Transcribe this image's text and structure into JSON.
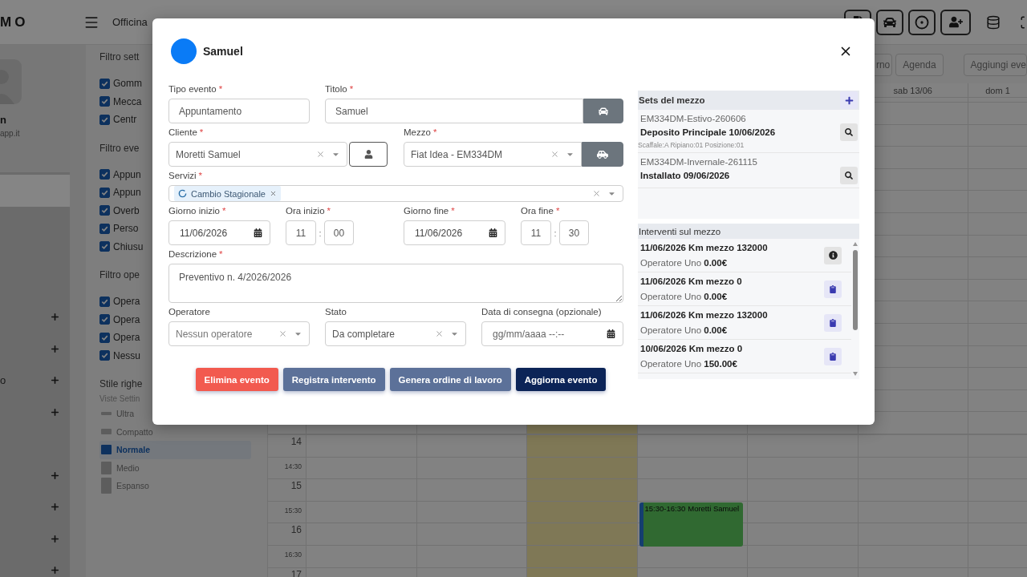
{
  "top_bar": {
    "logo": "MO",
    "title": "Officina",
    "actions": [
      {
        "kind": "document"
      },
      {
        "kind": "car"
      },
      {
        "kind": "target"
      },
      {
        "kind": "add-user"
      },
      {
        "kind": "database"
      },
      {
        "kind": "expand"
      }
    ]
  },
  "sidebar": {
    "user_name": "n",
    "user_email": "app.it",
    "nav_groups": [
      {
        "items": [
          {
            "selected": true,
            "expandable": false
          }
        ]
      },
      {
        "items": [
          {
            "selected": false,
            "expandable": true
          },
          {
            "selected": false,
            "expandable": true
          },
          {
            "selected": false,
            "expandable": true,
            "label": "o"
          },
          {
            "selected": false,
            "expandable": true
          }
        ]
      },
      {
        "items": [
          {
            "selected": false,
            "expandable": true
          },
          {
            "selected": false,
            "expandable": true
          },
          {
            "selected": false,
            "expandable": true
          },
          {
            "selected": false,
            "expandable": true
          }
        ]
      }
    ]
  },
  "filters": [
    {
      "title": "Filtro sett",
      "items": [
        {
          "label": "Gomm",
          "checked": true
        },
        {
          "label": "Mecca",
          "checked": true
        },
        {
          "label": "Centr",
          "checked": true
        }
      ]
    },
    {
      "title": "Filtro eve",
      "items": [
        {
          "label": "Appun",
          "checked": true
        },
        {
          "label": "Appun",
          "checked": true
        },
        {
          "label": "Overb",
          "checked": true
        },
        {
          "label": "Perso",
          "checked": true
        },
        {
          "label": "Chiusu",
          "checked": true
        }
      ]
    },
    {
      "title": "Filtro ope",
      "items": [
        {
          "label": "Opera",
          "checked": true
        },
        {
          "label": "Opera",
          "checked": true
        },
        {
          "label": "Opera",
          "checked": true
        },
        {
          "label": "Nessu",
          "checked": true
        }
      ]
    }
  ],
  "row_style": {
    "title": "Stile righe",
    "subtitle": "Viste Settin",
    "options": [
      {
        "label": "Ultra",
        "kind": "ultra",
        "selected": false
      },
      {
        "label": "Compatto",
        "kind": "compact",
        "selected": false
      },
      {
        "label": "Normale",
        "kind": "normal",
        "selected": true
      },
      {
        "label": "Medio",
        "kind": "medium",
        "selected": false
      },
      {
        "label": "Espanso",
        "kind": "expanded",
        "selected": false
      }
    ]
  },
  "calendar": {
    "toolbar": [
      {
        "label": "rno"
      },
      {
        "label": "Agenda"
      },
      {
        "label": "Aggiungi eve"
      }
    ],
    "columns": [
      {
        "today": false
      },
      {
        "today": false
      },
      {
        "today": true
      },
      {
        "today": false,
        "event": {
          "time": "15:30-16:30",
          "title": "Moretti Samuel"
        }
      },
      {
        "today": false
      },
      {
        "label": "sab 13/06",
        "today": false
      },
      {
        "label": "dom 1",
        "today": false
      }
    ],
    "rows": [
      {
        "time": "14",
        "kind": "hour"
      },
      {
        "time": "14:30",
        "kind": "half"
      },
      {
        "time": "15",
        "kind": "hour"
      },
      {
        "time": "15:30",
        "kind": "half",
        "event_start": true
      },
      {
        "time": "16",
        "kind": "hour"
      },
      {
        "time": "16:30",
        "kind": "half"
      },
      {
        "time": "17",
        "kind": "hour"
      }
    ]
  },
  "dialog": {
    "title": "Samuel",
    "event_type": {
      "label": "Tipo evento",
      "required": "*",
      "value": "Appuntamento"
    },
    "title_field": {
      "label": "Titolo",
      "required": "*",
      "value": "Samuel"
    },
    "client": {
      "label": "Cliente",
      "required": "*",
      "value": "Moretti Samuel"
    },
    "vehicle": {
      "label": "Mezzo",
      "required": "*",
      "value": "Fiat Idea - EM334DM"
    },
    "services": {
      "label": "Servizi",
      "required": "*",
      "tags": [
        "Cambio Stagionale"
      ]
    },
    "start_date": {
      "label": "Giorno inizio",
      "required": "*",
      "value": "11/06/2026"
    },
    "start_time": {
      "label": "Ora inizio",
      "required": "*",
      "hours": "11",
      "separator": ":",
      "minutes": "00"
    },
    "end_date": {
      "label": "Giorno fine",
      "required": "*",
      "value": "11/06/2026"
    },
    "end_time": {
      "label": "Ora fine",
      "required": "*",
      "hours": "11",
      "separator": ":",
      "minutes": "30"
    },
    "description": {
      "label": "Descrizione",
      "required": "*",
      "value": "Preventivo n. 4/2026/2026"
    },
    "operator": {
      "label": "Operatore",
      "placeholder": "Nessun operatore"
    },
    "status": {
      "label": "Stato",
      "value": "Da completare"
    },
    "delivery": {
      "label": "Data di consegna (opzionale)",
      "placeholder": "gg/mm/aaaa --:--"
    },
    "actions": [
      {
        "label": "Elimina evento",
        "kind": "danger"
      },
      {
        "label": "Registra intervento",
        "kind": "secondary"
      },
      {
        "label": "Genera ordine di lavoro",
        "kind": "secondary"
      },
      {
        "label": "Aggiorna evento",
        "kind": "primary"
      }
    ],
    "vehicle_sets": {
      "title": "Sets del mezzo",
      "items": [
        {
          "code": "EM334DM-Estivo-260606",
          "status": "Deposito Principale 10/06/2026",
          "location": "Scaffale:A Ripiano:01 Posizione:01"
        },
        {
          "code": "EM334DM-Invernale-261115",
          "status": "Installato 09/06/2026"
        }
      ]
    },
    "interventions": {
      "title": "Interventi sul mezzo",
      "items": [
        {
          "heading": "11/06/2026 Km mezzo 132000",
          "detail": "Operatore Uno **0.00€**",
          "kind": "info"
        },
        {
          "heading": "11/06/2026 Km mezzo 0",
          "detail": "Operatore Uno **0.00€**",
          "kind": "clipboard"
        },
        {
          "heading": "11/06/2026 Km mezzo 132000",
          "detail": "Operatore Uno **0.00€**",
          "kind": "clipboard"
        },
        {
          "heading": "10/06/2026 Km mezzo 0",
          "detail": "Operatore Uno **150.00€**",
          "kind": "clipboard"
        }
      ]
    }
  }
}
